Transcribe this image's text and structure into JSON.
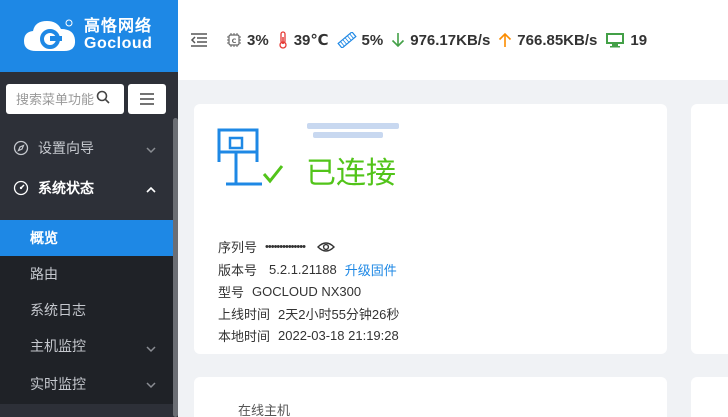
{
  "logo": {
    "cn": "高恪网络",
    "en": "Gocloud"
  },
  "search": {
    "placeholder": "搜索菜单功能"
  },
  "nav": {
    "setup_wizard": "设置向导",
    "system_status": "系统状态",
    "sub_items": [
      "概览",
      "路由",
      "系统日志",
      "主机监控",
      "实时监控"
    ]
  },
  "topbar": {
    "cpu": "3%",
    "temperature": "39℃",
    "memory": "5%",
    "download": "976.17KB/s",
    "upload": "766.85KB/s",
    "hosts": "19"
  },
  "status": {
    "connection": "已连接"
  },
  "info": {
    "serial_label": "序列号",
    "serial_value": "••••••••••••••",
    "version_label": "版本号",
    "version_value": "5.2.1.21188",
    "upgrade_link": "升级固件",
    "model_label": "型号",
    "model_value": "GOCLOUD NX300",
    "uptime_label": "上线时间",
    "uptime_value": "2天2小时55分钟26秒",
    "localtime_label": "本地时间",
    "localtime_value": "2022-03-18 21:19:28"
  },
  "bottom_card": {
    "title": "在线主机"
  },
  "colors": {
    "brand": "#1e88e5",
    "success": "#52c41a",
    "sidebar": "#2d3038"
  }
}
